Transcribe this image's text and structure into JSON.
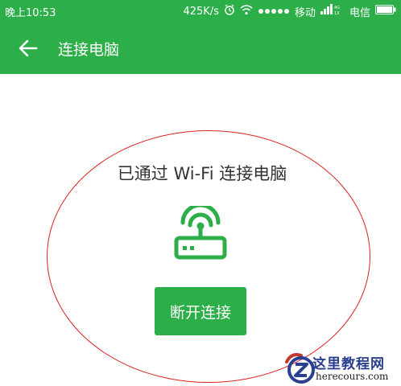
{
  "status_bar": {
    "time": "晚上10:53",
    "net_speed": "425K/s",
    "carrier1": "移动",
    "carrier2": "电信"
  },
  "toolbar": {
    "title": "连接电脑"
  },
  "main": {
    "connection_text": "已通过 Wi-Fi 连接电脑",
    "disconnect_label": "断开连接"
  },
  "watermark": {
    "title": "这里教程网",
    "subtitle": "herecours.com"
  },
  "colors": {
    "brand_green": "#2cae49",
    "annotation_red": "#e02020"
  }
}
